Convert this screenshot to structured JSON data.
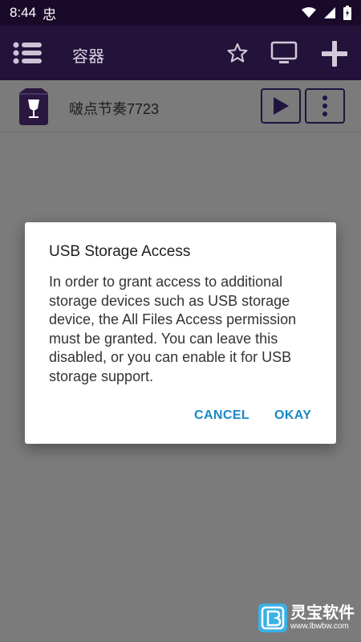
{
  "status_bar": {
    "time": "8:44",
    "notif_glyph": "忠"
  },
  "app_bar": {
    "title": "容器"
  },
  "containers": [
    {
      "name": "啵点节奏7723"
    }
  ],
  "dialog": {
    "title": "USB Storage Access",
    "body": "In order to grant access to additional storage devices such as USB storage device, the All Files Access permission must be granted. You can leave this disabled, or you can enable it for USB storage support.",
    "cancel_label": "CANCEL",
    "ok_label": "OKAY"
  },
  "watermark": {
    "name": "灵宝软件",
    "url": "www.lbwbw.com"
  },
  "colors": {
    "accent": "#1a88c9",
    "app_bar": "#23123a",
    "status_bar": "#1a0a2a"
  },
  "icons": [
    "menu-icon",
    "star-icon",
    "tv-icon",
    "plus-icon",
    "wine-icon",
    "play-icon",
    "more-vertical-icon",
    "wifi-icon",
    "signal-icon",
    "battery-icon"
  ]
}
